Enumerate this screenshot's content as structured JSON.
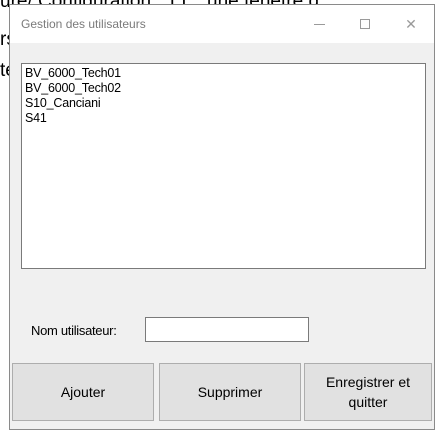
{
  "background_document": {
    "lines": [
      "ure/ Configuration : TT\", une fenêtre d",
      "rs",
      "te"
    ]
  },
  "window": {
    "title": "Gestion des utilisateurs",
    "controls": {
      "minimize_icon": "minimize-icon",
      "maximize_icon": "maximize-icon",
      "close_glyph": "✕"
    }
  },
  "users_list": {
    "items": [
      "BV_6000_Tech01",
      "BV_6000_Tech02",
      "S10_Canciani",
      "S41"
    ]
  },
  "username": {
    "label": "Nom utilisateur:",
    "value": "",
    "placeholder": ""
  },
  "buttons": {
    "add": "Ajouter",
    "delete": "Supprimer",
    "save_line1": "Enregistrer et",
    "save_line2": "quitter"
  }
}
